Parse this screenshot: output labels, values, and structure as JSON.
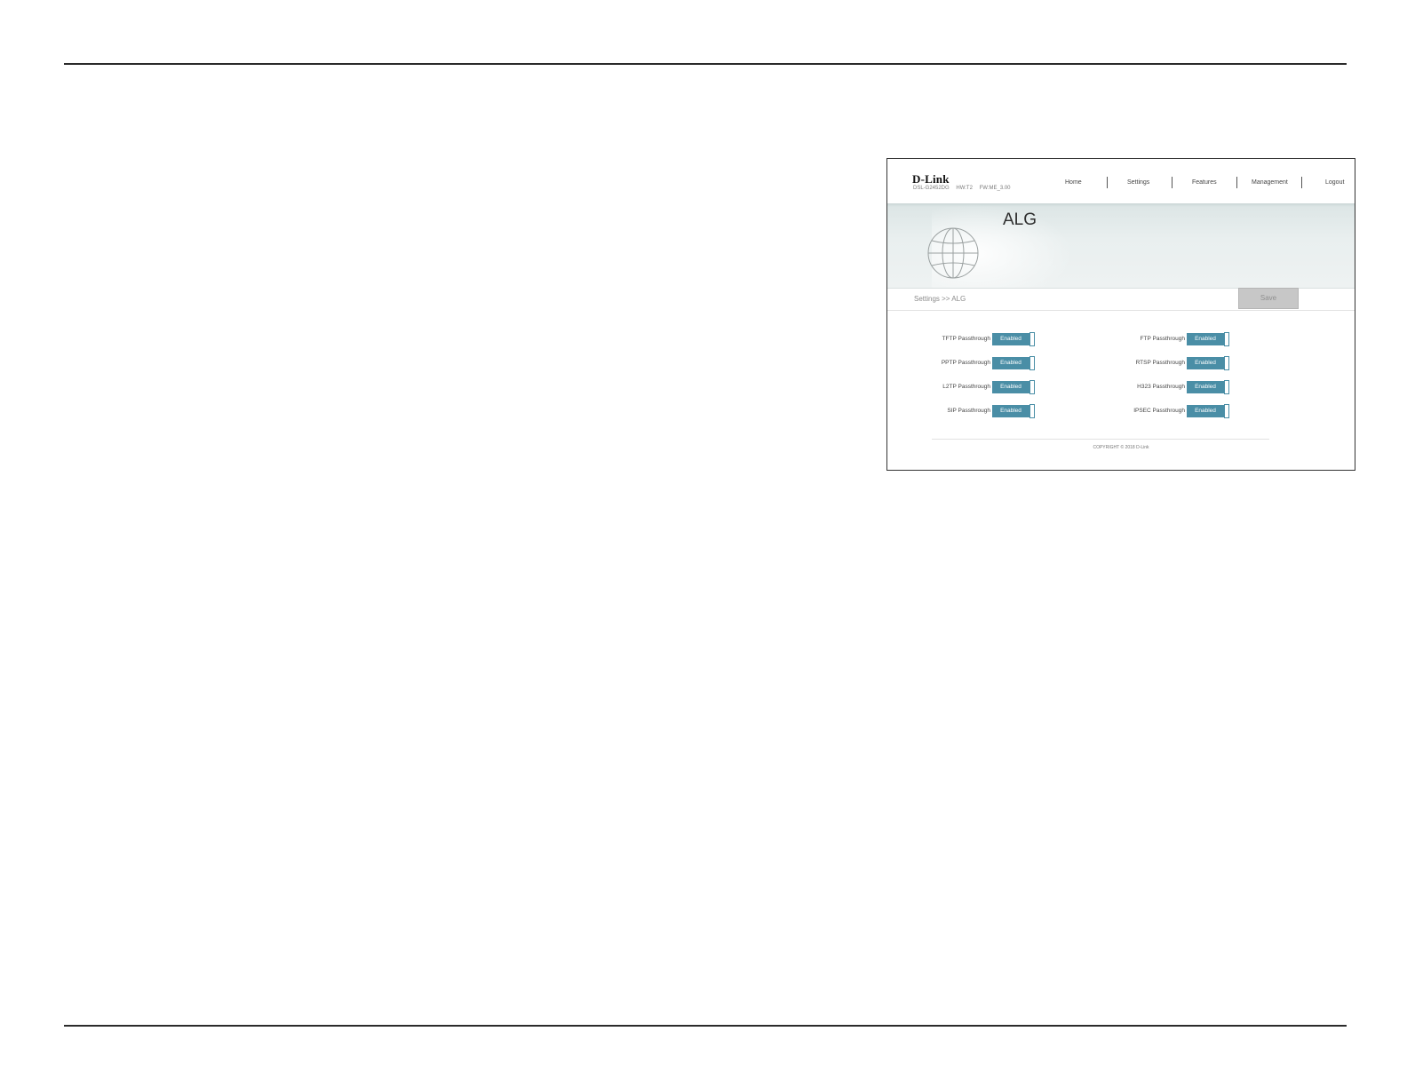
{
  "app": {
    "brand": "D-Link",
    "model_info": [
      "DSL-G2452DG",
      "HW:T2",
      "FW:ME_3.00"
    ]
  },
  "nav": {
    "items": [
      "Home",
      "Settings",
      "Features",
      "Management",
      "Logout"
    ]
  },
  "page": {
    "title": "ALG",
    "breadcrumb": "Settings >> ALG",
    "save_label": "Save"
  },
  "alg_options": [
    {
      "label": "TFTP Passthrough",
      "state": "Enabled"
    },
    {
      "label": "PPTP Passthrough",
      "state": "Enabled"
    },
    {
      "label": "L2TP Passthrough",
      "state": "Enabled"
    },
    {
      "label": "SIP Passthrough",
      "state": "Enabled"
    },
    {
      "label": "FTP Passthrough",
      "state": "Enabled"
    },
    {
      "label": "RTSP Passthrough",
      "state": "Enabled"
    },
    {
      "label": "H323 Passthrough",
      "state": "Enabled"
    },
    {
      "label": "IPSEC Passthrough",
      "state": "Enabled"
    }
  ],
  "footer": {
    "copyright": "COPYRIGHT © 2018 D-Link"
  },
  "colors": {
    "toggle_on": "#4a8ea6",
    "save_disabled": "#c7c7c7"
  }
}
